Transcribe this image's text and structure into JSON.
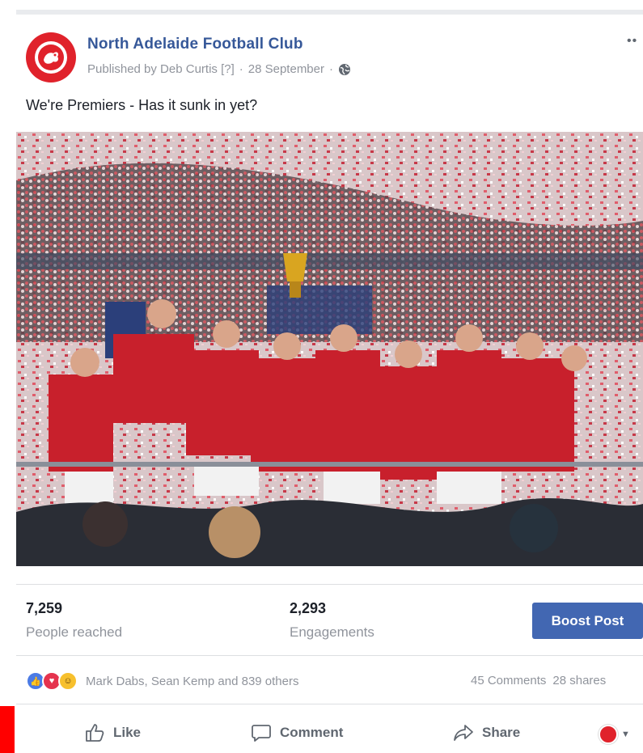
{
  "post": {
    "page_name": "North Adelaide Football Club",
    "published_by": "Published by Deb Curtis [?]",
    "date": "28 September",
    "text": "We're Premiers - Has it sunk in yet?",
    "more_icon": "ellipsis-icon",
    "privacy_icon": "globe-icon"
  },
  "stats": {
    "reach_value": "7,259",
    "reach_label": "People reached",
    "engagement_value": "2,293",
    "engagement_label": "Engagements",
    "boost_label": "Boost Post"
  },
  "reactions": {
    "icons": [
      "like-icon",
      "love-icon",
      "haha-icon"
    ],
    "names": "Mark Dabs, Sean Kemp and 839 others",
    "comments": "45 Comments",
    "shares": "28 shares"
  },
  "actions": {
    "like_label": "Like",
    "comment_label": "Comment",
    "share_label": "Share"
  },
  "colors": {
    "brand_blue": "#365899",
    "boost_blue": "#4267b2",
    "club_red": "#e0222b"
  }
}
